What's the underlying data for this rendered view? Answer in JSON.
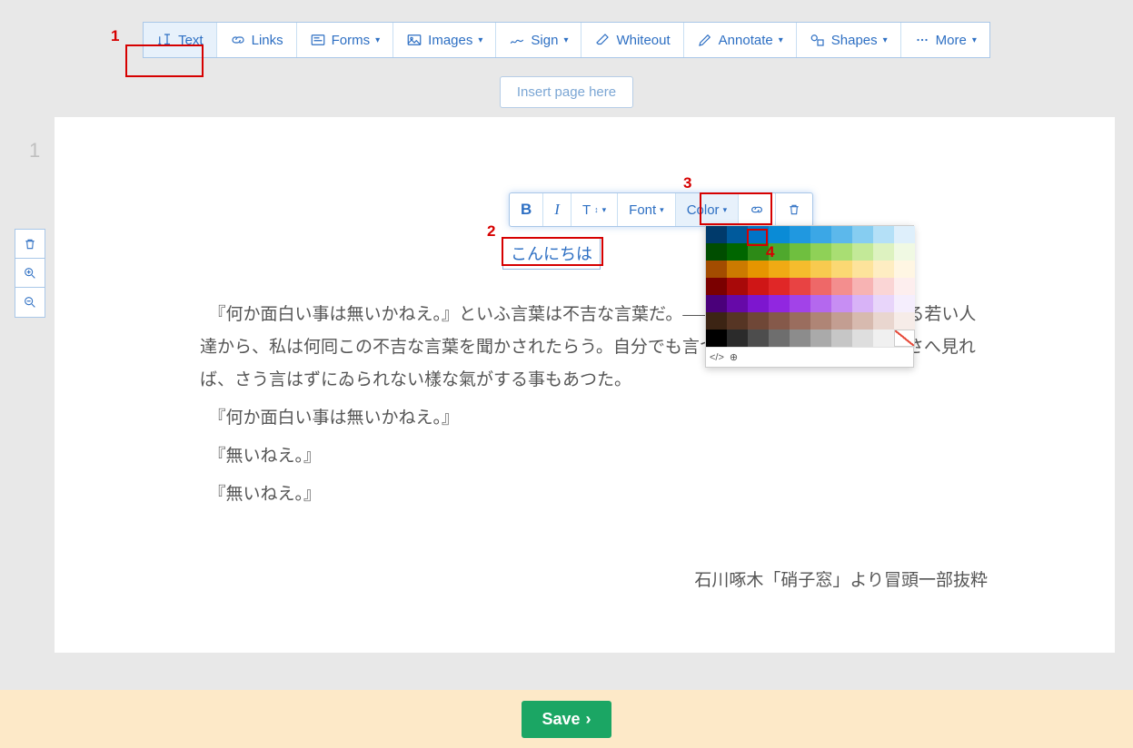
{
  "toolbar": {
    "items": [
      {
        "label": "Text",
        "dropdown": false,
        "icon": "text-edit"
      },
      {
        "label": "Links",
        "dropdown": false,
        "icon": "link"
      },
      {
        "label": "Forms",
        "dropdown": true,
        "icon": "form"
      },
      {
        "label": "Images",
        "dropdown": true,
        "icon": "image"
      },
      {
        "label": "Sign",
        "dropdown": true,
        "icon": "sign"
      },
      {
        "label": "Whiteout",
        "dropdown": false,
        "icon": "eraser"
      },
      {
        "label": "Annotate",
        "dropdown": true,
        "icon": "pen"
      },
      {
        "label": "Shapes",
        "dropdown": true,
        "icon": "shapes"
      },
      {
        "label": "More",
        "dropdown": true,
        "icon": "dots"
      }
    ]
  },
  "insert_page_label": "Insert page here",
  "page_number": "1",
  "text_toolbar": {
    "bold": "B",
    "italic": "I",
    "size": "T",
    "font": "Font",
    "color": "Color"
  },
  "inserted_text": "こんにちは",
  "document": {
    "p1": "　『何か面白い事は無いかねえ。』といふ言葉は不吉な言葉だ。――近頃私をたづさはつてゐる若い人達から、私は何囘この不吉な言葉を聞かされたらう。自分でも言つた。――或時は、人の顏さへ見れば、さう言はずにゐられない樣な氣がする事もあつた。",
    "p2": "　『何か面白い事は無いかねえ。』",
    "p3": "　『無いねえ。』",
    "p4": "　『無いねえ。』",
    "credit": "石川啄木「硝子窓」より冒頭一部抜粋"
  },
  "save_label": "Save",
  "annotations": {
    "1": "1",
    "2": "2",
    "3": "3",
    "4": "4"
  },
  "color_rows": [
    [
      "#003a6b",
      "#005a9c",
      "#0074c7",
      "#0a8bd6",
      "#2098e0",
      "#3ba7e6",
      "#5cb8eb",
      "#86cdf1",
      "#b4e0f7",
      "#deeffb"
    ],
    [
      "#004d00",
      "#006600",
      "#2d8a17",
      "#4fa82d",
      "#6fbf3f",
      "#8fd157",
      "#a9de73",
      "#c3e998",
      "#ddf2c0",
      "#f0f9e3"
    ],
    [
      "#a34c00",
      "#cc7a00",
      "#e69500",
      "#f0aa14",
      "#f5bc2d",
      "#f8ca4f",
      "#fbd873",
      "#fde39b",
      "#feedc2",
      "#fff6e3"
    ],
    [
      "#7a0000",
      "#a80909",
      "#cf1616",
      "#e02727",
      "#e84343",
      "#ee6868",
      "#f38e8e",
      "#f7b3b3",
      "#fad5d5",
      "#fdeeee"
    ],
    [
      "#4a007a",
      "#6609a8",
      "#7d16cf",
      "#9127e0",
      "#a243e8",
      "#b468ee",
      "#c78ef3",
      "#d8b3f7",
      "#e8d5fa",
      "#f5eefd"
    ],
    [
      "#3c2414",
      "#563524",
      "#6f4737",
      "#85594a",
      "#9a6d5e",
      "#af8576",
      "#c39e92",
      "#d7baaf",
      "#e9d6cf",
      "#f6ece8"
    ],
    [
      "#000000",
      "#2b2b2b",
      "#4d4d4d",
      "#6e6e6e",
      "#8c8c8c",
      "#aaaaaa",
      "#c6c6c6",
      "#dedede",
      "#f0f0f0",
      "#ffffff"
    ]
  ],
  "color_footer": {
    "code": "</>"
  }
}
